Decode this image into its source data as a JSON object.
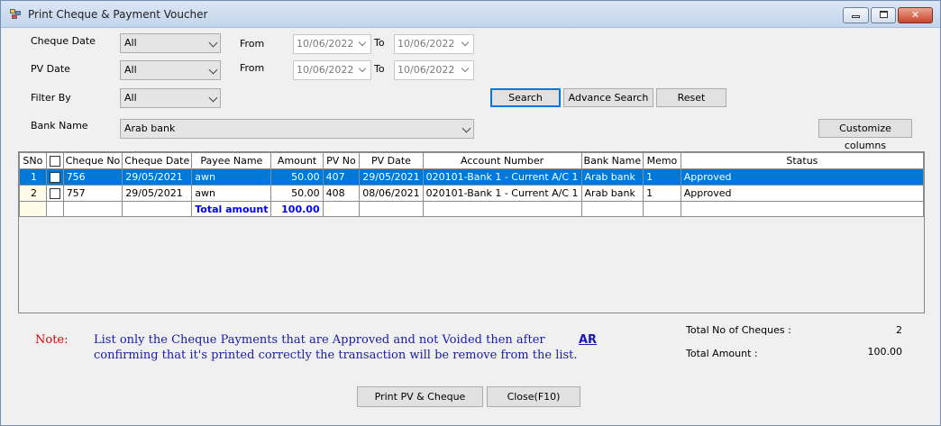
{
  "window": {
    "title": "Print Cheque & Payment Voucher"
  },
  "filters": {
    "cheque_date_label": "Cheque Date",
    "cheque_date_value": "All",
    "pv_date_label": "PV Date",
    "pv_date_value": "All",
    "filter_by_label": "Filter By",
    "filter_by_value": "All",
    "bank_name_label": "Bank Name",
    "bank_name_value": "Arab bank",
    "from_label": "From",
    "to_label": "To",
    "cheque_from": "10/06/2022",
    "cheque_to": "10/06/2022",
    "pv_from": "10/06/2022",
    "pv_to": "10/06/2022"
  },
  "buttons": {
    "search": "Search",
    "advance_search": "Advance Search",
    "reset": "Reset",
    "customize_columns": "Customize columns",
    "print": "Print PV & Cheque",
    "close": "Close(F10)"
  },
  "grid": {
    "columns": [
      "SNo",
      "",
      "Cheque No",
      "Cheque Date",
      "Payee Name",
      "Amount",
      "PV No",
      "PV Date",
      "Account Number",
      "Bank Name",
      "Memo",
      "Status"
    ],
    "rows": [
      {
        "sno": "1",
        "cheque_no": "756",
        "cheque_date": "29/05/2021",
        "payee": "awn",
        "amount": "50.00",
        "pv_no": "407",
        "pv_date": "29/05/2021",
        "account": "020101-Bank 1 - Current A/C 1",
        "bank": "Arab bank",
        "memo": "1",
        "status": "Approved"
      },
      {
        "sno": "2",
        "cheque_no": "757",
        "cheque_date": "29/05/2021",
        "payee": "awn",
        "amount": "50.00",
        "pv_no": "408",
        "pv_date": "08/06/2021",
        "account": "020101-Bank 1 - Current A/C 1",
        "bank": "Arab bank",
        "memo": "1",
        "status": "Approved"
      }
    ],
    "total_label": "Total amount",
    "total_value": "100.00"
  },
  "note": {
    "label": "Note:",
    "text": "List only the Cheque Payments that are Approved and not Voided then after confirming that it's printed correctly the transaction will be remove from the list.",
    "link": "AR"
  },
  "summary": {
    "count_label": "Total No of Cheques :",
    "count_value": "2",
    "amount_label": "Total Amount :",
    "amount_value": "100.00"
  },
  "colors": {
    "selection": "#0078d7",
    "note_label": "#e00000",
    "note_text": "#1a1ab3",
    "total": "#0000ff"
  }
}
